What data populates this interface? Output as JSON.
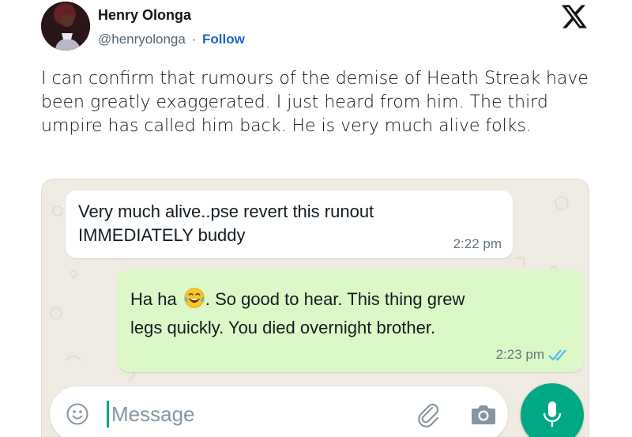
{
  "tweet": {
    "author_name": "Henry Olonga",
    "author_handle": "@henryolonga",
    "separator": "·",
    "follow_label": "Follow",
    "logo_icon": "x-logo-icon",
    "text": "I can confirm that rumours of the demise of Heath Streak have been greatly exaggerated.  I just heard from him. The third umpire has called him back. He is very much alive folks."
  },
  "chat": {
    "received": {
      "line1": "Very much alive..pse revert this runout",
      "line2": "IMMEDIATELY buddy",
      "time": "2:22 pm"
    },
    "sent": {
      "part1": "Ha ha",
      "emoji": "face-with-tears-of-joy",
      "part2": ".  So good to hear. This thing grew",
      "line2": "legs quickly. You died overnight brother.",
      "time": "2:23 pm",
      "status_icon": "double-check-icon"
    },
    "input": {
      "placeholder": "Message"
    }
  },
  "colors": {
    "follow": "#1d63c9",
    "chat_background": "#efeae2",
    "sent_bubble": "#dcf8c6",
    "accent_green": "#00a884",
    "read_ticks": "#53bdeb"
  }
}
